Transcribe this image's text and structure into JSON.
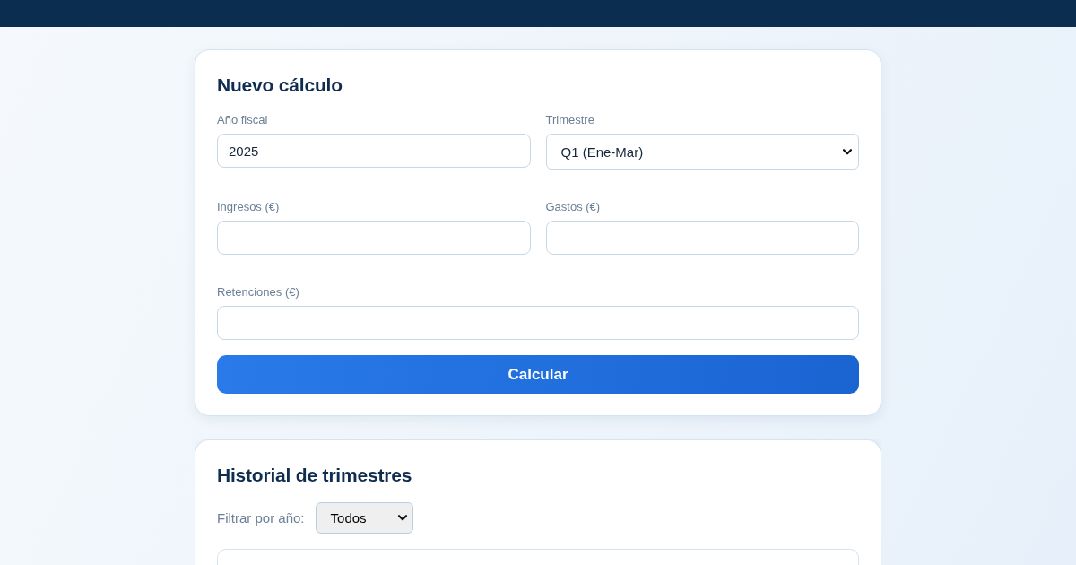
{
  "new_calculation": {
    "title": "Nuevo cálculo",
    "rows": [
      [
        {
          "kind": "input",
          "label": "Año fiscal",
          "value": "2025"
        },
        {
          "kind": "select",
          "label": "Trimestre",
          "value": "Q1 (Ene-Mar)"
        }
      ],
      [
        {
          "kind": "input",
          "label": "Ingresos (€)"
        },
        {
          "kind": "input",
          "label": "Gastos (€)"
        }
      ],
      [
        {
          "kind": "input",
          "label": "Retenciones (€)"
        }
      ]
    ],
    "submit": "Calcular"
  },
  "history": {
    "title": "Historial de trimestres",
    "filter": {
      "label": "Filtrar por año:",
      "value": "Todos"
    }
  }
}
